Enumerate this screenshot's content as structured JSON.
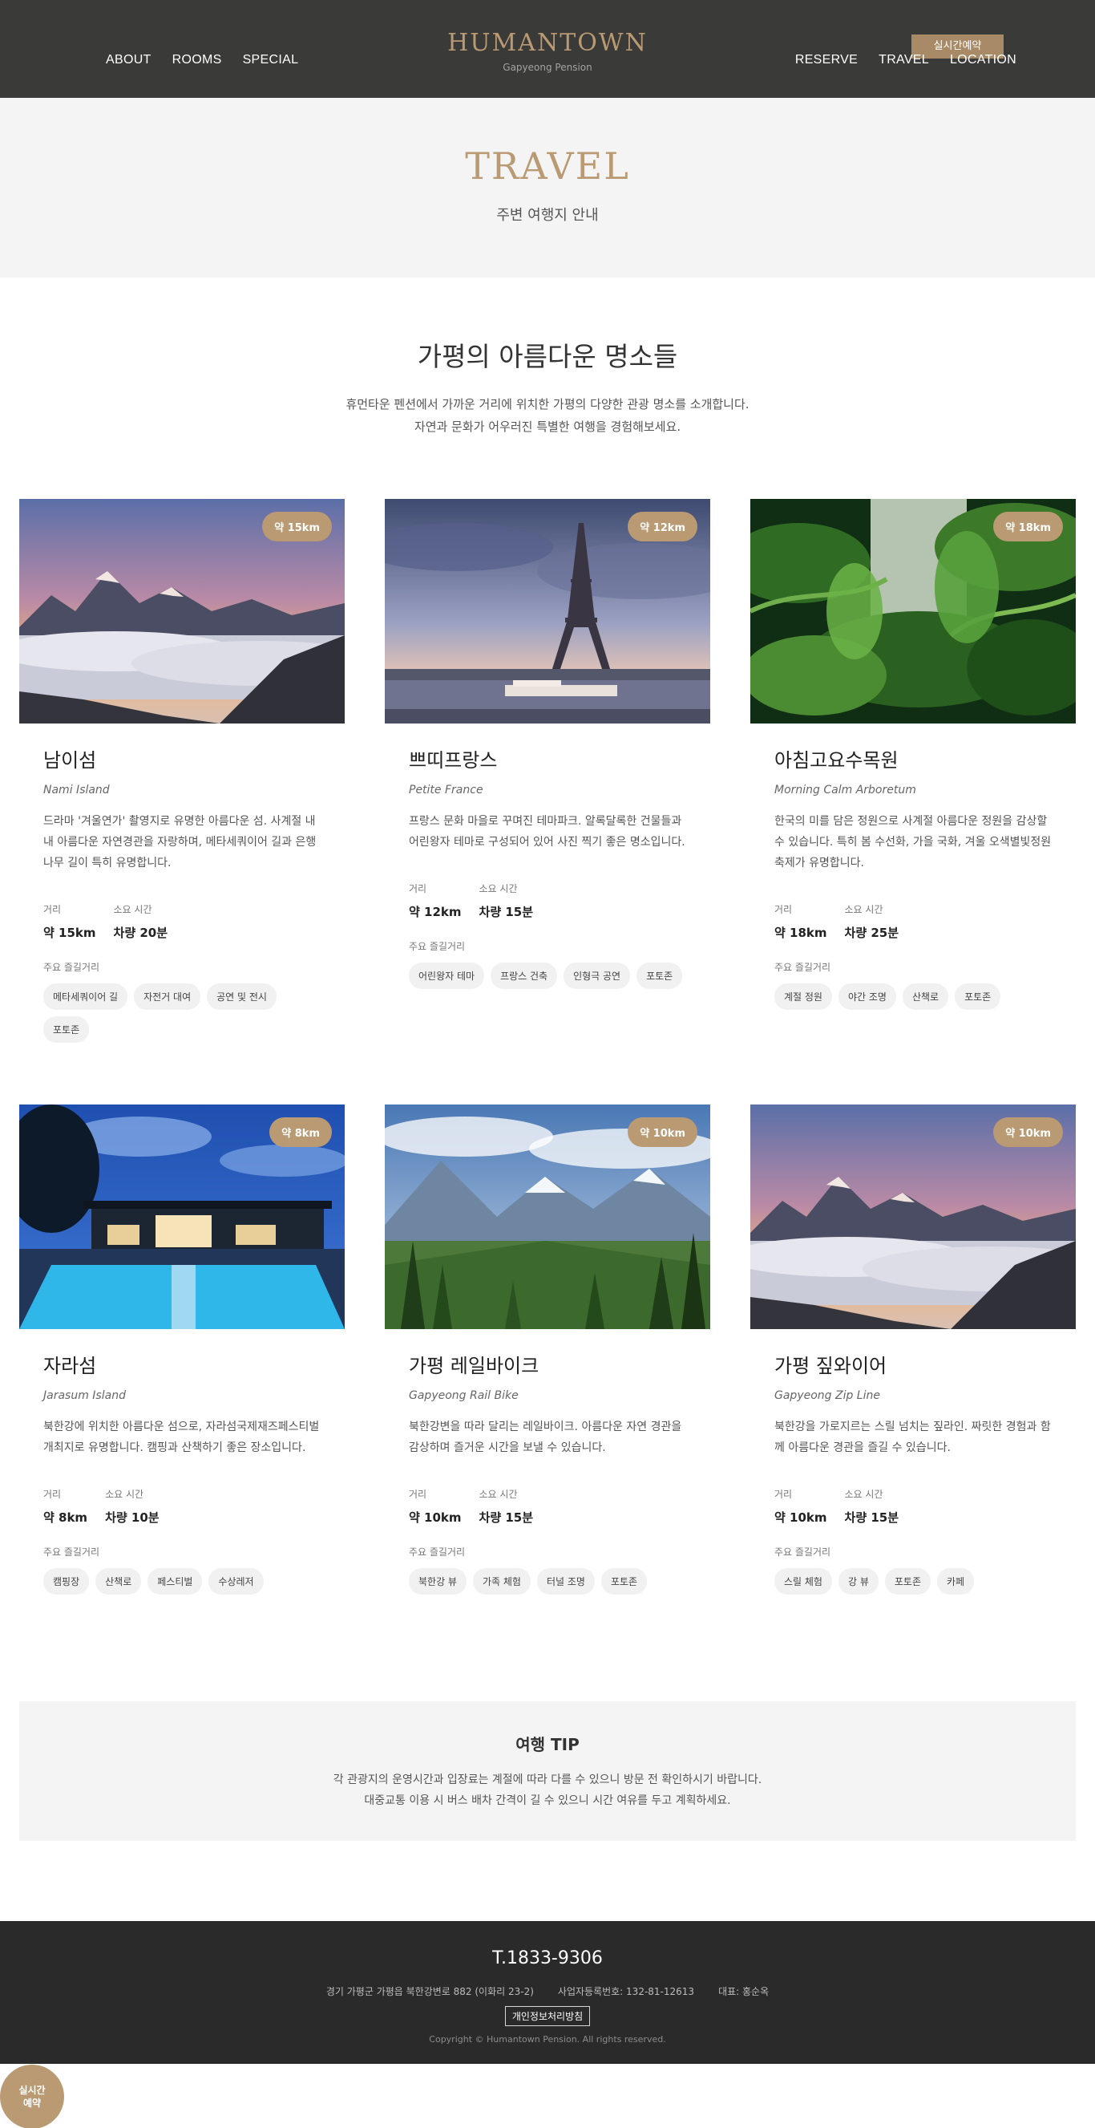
{
  "header": {
    "nav_left": [
      "ABOUT",
      "ROOMS",
      "SPECIAL"
    ],
    "nav_right": [
      "RESERVE",
      "TRAVEL",
      "LOCATION"
    ],
    "brand": "HUMANTOWN",
    "brand_sub": "Gapyeong Pension",
    "reserve_button": "실시간예약"
  },
  "hero": {
    "title": "TRAVEL",
    "subtitle": "주변 여행지 안내"
  },
  "intro": {
    "title": "가평의 아름다운 명소들",
    "desc_line1": "휴먼타운 펜션에서 가까운 거리에 위치한 가평의 다양한 관광 명소를 소개합니다.",
    "desc_line2": "자연과 문화가 어우러진 특별한 여행을 경험해보세요."
  },
  "labels": {
    "distance": "거리",
    "duration": "소요 시간",
    "attractions": "주요 즐길거리"
  },
  "cards": [
    {
      "badge": "약 15km",
      "title": "남이섬",
      "en": "Nami Island",
      "desc": "드라마 '겨울연가' 촬영지로 유명한 아름다운 섬. 사계절 내내 아름다운 자연경관을 자랑하며, 메타세쿼이어 길과 은행나무 길이 특히 유명합니다.",
      "distance": "약 15km",
      "duration": "차량 20분",
      "tags": [
        "메타세쿼이어 길",
        "자전거 대여",
        "공연 및 전시",
        "포토존"
      ],
      "image": "mountain-sunset"
    },
    {
      "badge": "약 12km",
      "title": "쁘띠프랑스",
      "en": "Petite France",
      "desc": "프랑스 문화 마을로 꾸며진 테마파크. 알록달록한 건물들과 어린왕자 테마로 구성되어 있어 사진 찍기 좋은 명소입니다.",
      "distance": "약 12km",
      "duration": "차량 15분",
      "tags": [
        "어린왕자 테마",
        "프랑스 건축",
        "인형극 공연",
        "포토존"
      ],
      "image": "eiffel-tower"
    },
    {
      "badge": "약 18km",
      "title": "아침고요수목원",
      "en": "Morning Calm Arboretum",
      "desc": "한국의 미를 담은 정원으로 사계절 아름다운 정원을 감상할 수 있습니다. 특히 봄 수선화, 가을 국화, 겨울 오색별빛정원축제가 유명합니다.",
      "distance": "약 18km",
      "duration": "차량 25분",
      "tags": [
        "계절 정원",
        "야간 조명",
        "산책로",
        "포토존"
      ],
      "image": "jungle-leaves"
    },
    {
      "badge": "약 8km",
      "title": "자라섬",
      "en": "Jarasum Island",
      "desc": "북한강에 위치한 아름다운 섬으로, 자라섬국제재즈페스티벌 개최지로 유명합니다. 캠핑과 산책하기 좋은 장소입니다.",
      "distance": "약 8km",
      "duration": "차량 10분",
      "tags": [
        "캠핑장",
        "산책로",
        "페스티벌",
        "수상레저"
      ],
      "image": "resort-pool"
    },
    {
      "badge": "약 10km",
      "title": "가평 레일바이크",
      "en": "Gapyeong Rail Bike",
      "desc": "북한강변을 따라 달리는 레일바이크. 아름다운 자연 경관을 감상하며 즐거운 시간을 보낼 수 있습니다.",
      "distance": "약 10km",
      "duration": "차량 15분",
      "tags": [
        "북한강 뷰",
        "가족 체험",
        "터널 조명",
        "포토존"
      ],
      "image": "mountain-forest"
    },
    {
      "badge": "약 10km",
      "title": "가평 짚와이어",
      "en": "Gapyeong Zip Line",
      "desc": "북한강을 가로지르는 스릴 넘치는 짚라인. 짜릿한 경험과 함께 아름다운 경관을 즐길 수 있습니다.",
      "distance": "약 10km",
      "duration": "차량 15분",
      "tags": [
        "스릴 체험",
        "강 뷰",
        "포토존",
        "카페"
      ],
      "image": "mountain-sunset"
    }
  ],
  "tip": {
    "title": "여행 TIP",
    "line1": "각 관광지의 운영시간과 입장료는 계절에 따라 다를 수 있으니 방문 전 확인하시기 바랍니다.",
    "line2": "대중교통 이용 시 버스 배차 간격이 길 수 있으니 시간 여유를 두고 계획하세요."
  },
  "footer": {
    "phone": "T.1833-9306",
    "address": "경기 가평군 가평읍 북한강변로 882 (이화리 23-2)",
    "business": "사업자등록번호: 132-81-12613",
    "ceo": "대표: 홍순옥",
    "privacy": "개인정보처리방침",
    "copyright": "Copyright © Humantown Pension. All rights reserved."
  },
  "float_button": {
    "line1": "실시간",
    "line2": "예약"
  },
  "colors": {
    "accent": "#b99a73",
    "header_bg": "#3a3a38",
    "footer_bg": "#2a2a2a"
  }
}
